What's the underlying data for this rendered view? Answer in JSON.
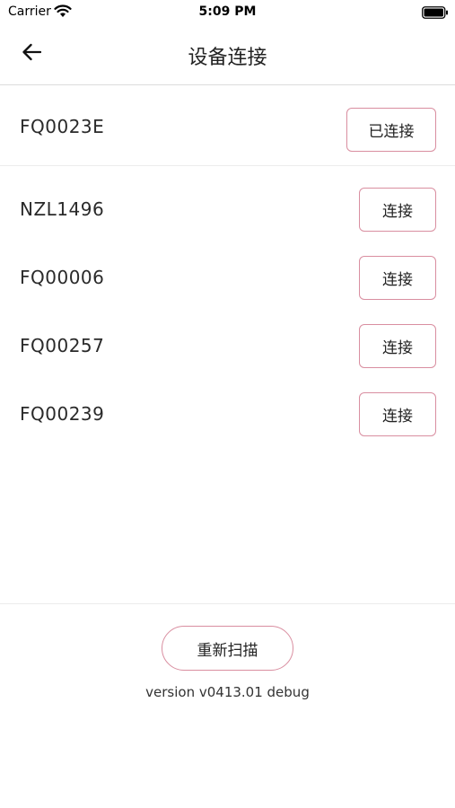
{
  "status_bar": {
    "carrier": "Carrier",
    "time": "5:09 PM",
    "icons": [
      "wifi-icon",
      "battery-icon"
    ]
  },
  "nav": {
    "title": "设备连接",
    "back_icon": "arrow-left-icon"
  },
  "connected_device": {
    "name": "FQ0023E",
    "button_label": "已连接"
  },
  "devices": [
    {
      "name": "NZL1496",
      "button_label": "连接"
    },
    {
      "name": "FQ00006",
      "button_label": "连接"
    },
    {
      "name": "FQ00257",
      "button_label": "连接"
    },
    {
      "name": "FQ00239",
      "button_label": "连接"
    }
  ],
  "footer": {
    "rescan_label": "重新扫描",
    "version": "version v0413.01 debug"
  },
  "colors": {
    "accent_border": "#d98ea0",
    "divider": "#dcdcdc",
    "background": "#ffffff"
  }
}
